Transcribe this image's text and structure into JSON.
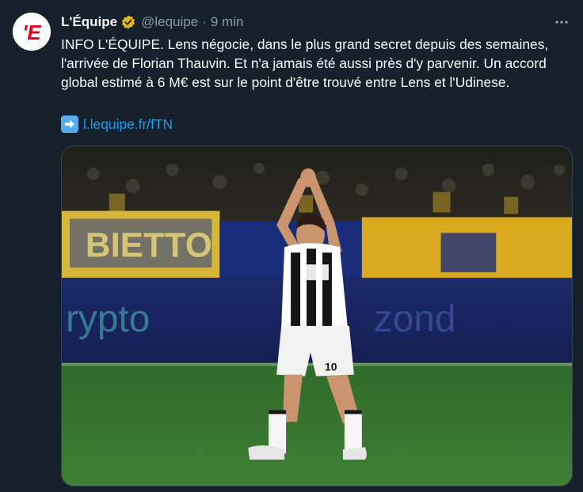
{
  "account": {
    "display_name": "L'Équipe",
    "handle": "@lequipe",
    "separator": "·",
    "time": "9 min",
    "avatar_text": "'E"
  },
  "tweet": {
    "text": "INFO L'ÉQUIPE. Lens négocie, dans le plus grand secret depuis des semaines, l'arrivée de Florian Thauvin. Et n'a jamais été aussi près d'y parvenir. Un accord global estimé à 6 M€ est sur le point d'être trouvé entre Lens et l'Udinese.",
    "link_text": "l.lequipe.fr/fTN",
    "link_prefix_icon": "right-arrow-emoji"
  },
  "media": {
    "banner_left_text": "BIETTO",
    "board_text_left": "rypto",
    "board_text_right": "zond",
    "shirt_number": "10"
  },
  "colors": {
    "background": "#15202b",
    "text": "#f7f9f9",
    "secondary": "#8b98a5",
    "link": "#1d9bf0",
    "verified_gold": "#e2b719",
    "brand_red": "#e3001b"
  },
  "icons": {
    "more": "more-horizontal-icon",
    "verified": "verified-badge-icon"
  }
}
